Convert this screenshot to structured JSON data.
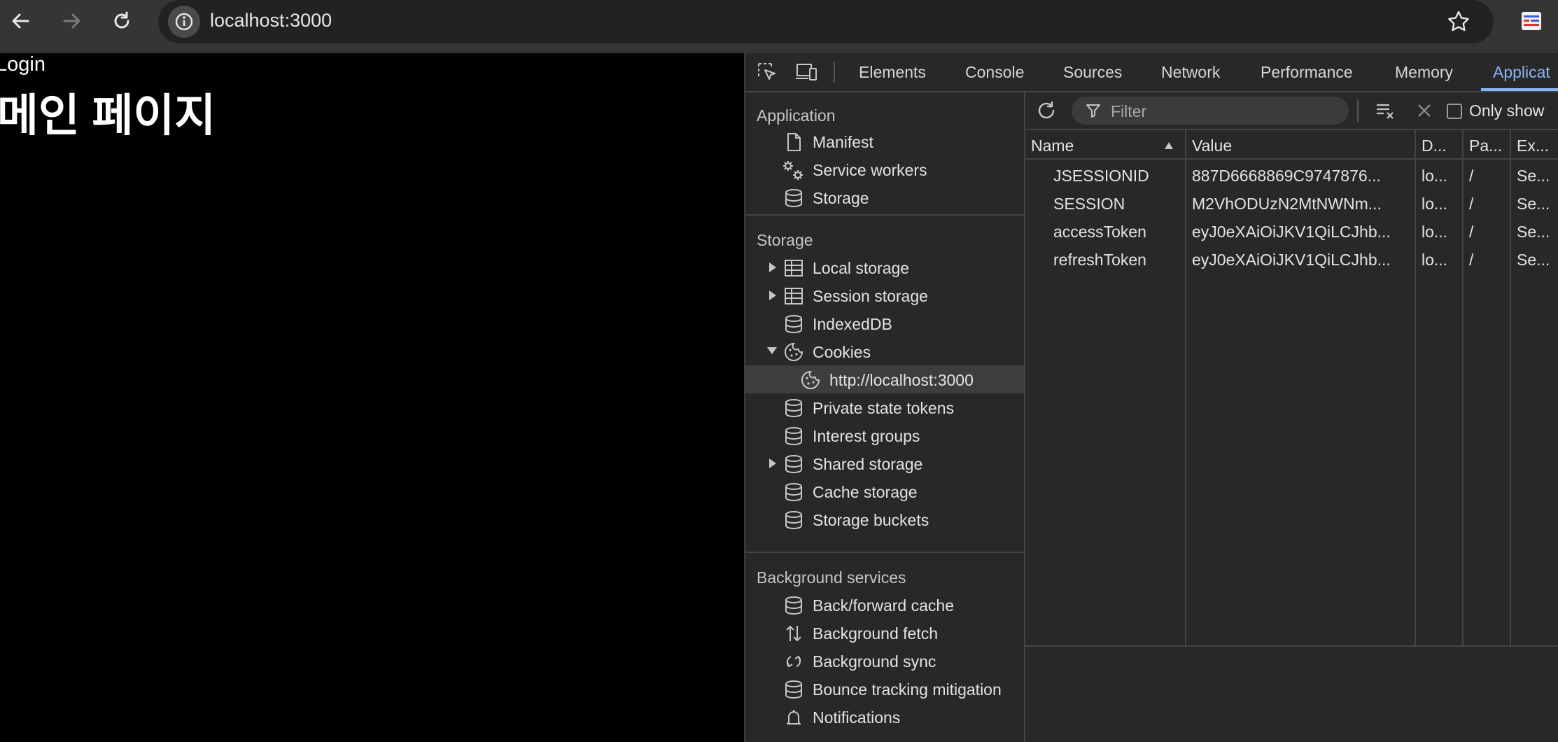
{
  "browser": {
    "url": "localhost:3000"
  },
  "page": {
    "login_text": "Login",
    "heading": "메인 페이지"
  },
  "devtools": {
    "tabs": [
      "Elements",
      "Console",
      "Sources",
      "Network",
      "Performance",
      "Memory",
      "Applicat"
    ],
    "active_tab": "Applicat",
    "accent_color": "#8ab4f8",
    "sidebar": {
      "application_title": "Application",
      "application_items": [
        {
          "label": "Manifest",
          "icon": "file-icon"
        },
        {
          "label": "Service workers",
          "icon": "gears-icon"
        },
        {
          "label": "Storage",
          "icon": "database-icon"
        }
      ],
      "storage_title": "Storage",
      "storage_items": [
        {
          "label": "Local storage",
          "icon": "table-icon",
          "expandable": true
        },
        {
          "label": "Session storage",
          "icon": "table-icon",
          "expandable": true
        },
        {
          "label": "IndexedDB",
          "icon": "database-icon"
        },
        {
          "label": "Cookies",
          "icon": "cookie-icon",
          "expanded": true
        },
        {
          "label": "http://localhost:3000",
          "icon": "cookie-icon",
          "selected": true,
          "child": true
        },
        {
          "label": "Private state tokens",
          "icon": "database-icon"
        },
        {
          "label": "Interest groups",
          "icon": "database-icon"
        },
        {
          "label": "Shared storage",
          "icon": "database-icon",
          "expandable": true
        },
        {
          "label": "Cache storage",
          "icon": "database-icon"
        },
        {
          "label": "Storage buckets",
          "icon": "database-icon"
        }
      ],
      "background_title": "Background services",
      "background_items": [
        {
          "label": "Back/forward cache",
          "icon": "database-icon"
        },
        {
          "label": "Background fetch",
          "icon": "arrows-updown-icon"
        },
        {
          "label": "Background sync",
          "icon": "sync-icon"
        },
        {
          "label": "Bounce tracking mitigation",
          "icon": "database-icon"
        },
        {
          "label": "Notifications",
          "icon": "bell-icon"
        }
      ]
    },
    "cookies": {
      "filter_placeholder": "Filter",
      "only_show_label": "Only show",
      "columns": [
        "Name",
        "Value",
        "D...",
        "Pa...",
        "Ex..."
      ],
      "rows": [
        [
          "JSESSIONID",
          "887D6668869C9747876...",
          "lo...",
          "/",
          "Se..."
        ],
        [
          "SESSION",
          "M2VhODUzN2MtNWNm...",
          "lo...",
          "/",
          "Se..."
        ],
        [
          "accessToken",
          "eyJ0eXAiOiJKV1QiLCJhb...",
          "lo...",
          "/",
          "Se..."
        ],
        [
          "refreshToken",
          "eyJ0eXAiOiJKV1QiLCJhb...",
          "lo...",
          "/",
          "Se..."
        ]
      ]
    }
  }
}
